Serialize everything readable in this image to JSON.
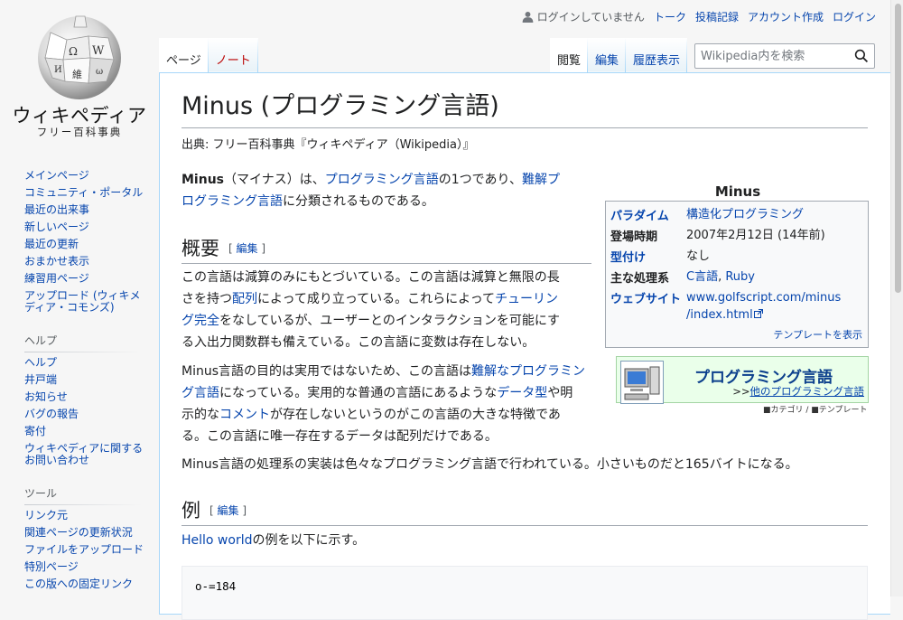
{
  "logo": {
    "wordmark": "ウィキペディア",
    "tagline": "フリー百科事典"
  },
  "personal": {
    "anon": "ログインしていません",
    "links": [
      "トーク",
      "投稿記録",
      "アカウント作成",
      "ログイン"
    ]
  },
  "tabs": {
    "left": [
      {
        "label": "ページ"
      },
      {
        "label": "ノート"
      }
    ],
    "right": [
      {
        "label": "閲覧"
      },
      {
        "label": "編集"
      },
      {
        "label": "履歴表示"
      }
    ]
  },
  "search": {
    "placeholder": "Wikipedia内を検索"
  },
  "sidebar": {
    "main": [
      "メインページ",
      "コミュニティ・ポータル",
      "最近の出来事",
      "新しいページ",
      "最近の更新",
      "おまかせ表示",
      "練習用ページ",
      "アップロード (ウィキメディア・コモンズ)"
    ],
    "help": {
      "heading": "ヘルプ",
      "items": [
        "ヘルプ",
        "井戸端",
        "お知らせ",
        "バグの報告",
        "寄付",
        "ウィキペディアに関するお問い合わせ"
      ]
    },
    "tools": {
      "heading": "ツール",
      "items": [
        "リンク元",
        "関連ページの更新状況",
        "ファイルをアップロード",
        "特別ページ",
        "この版への固定リンク"
      ]
    }
  },
  "article": {
    "title": "Minus (プログラミング言語)",
    "site_sub": "出典: フリー百科事典『ウィキペディア（Wikipedia）』",
    "intro": {
      "bold": "Minus",
      "t1": "（マイナス）は、",
      "l1": "プログラミング言語",
      "t2": "の1つであり、",
      "l2a": "難解プ",
      "l2b": "ログラミング言語",
      "t3": "に分類されるものである。"
    },
    "section1": {
      "title": "概要",
      "edit_open": "[",
      "edit": "編集",
      "edit_close": "]"
    },
    "p1": {
      "line1": "この言語は減算のみにもとづいている。この言語は減算と無限の長",
      "line2a": "さを持つ",
      "line2link": "配列",
      "line2b": "によって成り立っている。これらによって",
      "line2link2": "チューリン",
      "line3link": "グ完全",
      "line3b": "をなしているが、ユーザーとのインタラクションを可能にす",
      "line4": "る入出力関数群も備えている。この言語に変数は存在しない。"
    },
    "p2": {
      "line1a": "Minus言語の目的は実用ではないため、この言語は",
      "line1link": "難解なプログラミン",
      "line2link": "グ言語",
      "line2b": "になっている。実用的な普通の言語にあるような",
      "line2link2": "データ型",
      "line2c": "や明",
      "line3a": "示的な",
      "line3link": "コメント",
      "line3b": "が存在しないというのがこの言語の大きな特徴であ",
      "line4": "る。この言語に唯一存在するデータは配列だけである。"
    },
    "p3": "Minus言語の処理系の実装は色々なプログラミング言語で行われている。小さいものだと165バイトになる。",
    "section2": {
      "title": "例",
      "edit_open": "[",
      "edit": "編集",
      "edit_close": "]"
    },
    "p4": {
      "link": "Hello world",
      "text": "の例を以下に示す。"
    },
    "code": "o-=184"
  },
  "infobox": {
    "title": "Minus",
    "rows": [
      {
        "label": "パラダイム",
        "value": "構造化プログラミング"
      },
      {
        "label": "登場時期",
        "value": "2007年2月12日 (14年前)"
      },
      {
        "label": "型付け",
        "value": "なし"
      },
      {
        "label": "主な処理系",
        "value_a": "C言語",
        "sep": ", ",
        "value_b": "Ruby"
      },
      {
        "label": "ウェブサイト",
        "value_1": "www.golfscript.com/minus",
        "value_2": "/index.html"
      }
    ],
    "footer": "テンプレートを表示"
  },
  "portal": {
    "title": "プログラミング言語",
    "other_prefix": ">>",
    "other": "他のプログラミング言語",
    "sub": "■カテゴリ / ■テンプレート"
  },
  "colors": {
    "link": "#0645ad",
    "new_link": "#ba0000",
    "border": "#a7d7f9"
  }
}
